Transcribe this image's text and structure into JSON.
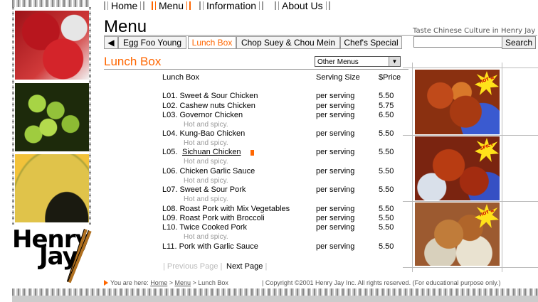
{
  "nav": {
    "items": [
      {
        "label": "Home",
        "active": false
      },
      {
        "label": "Menu",
        "active": true
      },
      {
        "label": "Information",
        "active": false
      },
      {
        "label": "About Us",
        "active": false
      }
    ]
  },
  "header": {
    "title": "Menu",
    "tagline": "Taste Chinese Culture in Henry Jay"
  },
  "tabs": [
    {
      "label": "Egg Foo Young",
      "selected": false
    },
    {
      "label": "Lunch Box",
      "selected": true
    },
    {
      "label": "Chop Suey & Chou Mein",
      "selected": false
    },
    {
      "label": "Chef's Special",
      "selected": false
    }
  ],
  "search": {
    "button_label": "Search",
    "value": ""
  },
  "section": {
    "title": "Lunch Box",
    "other_menus": "Other Menus"
  },
  "table": {
    "headers": {
      "item": "Lunch Box",
      "serving": "Serving Size",
      "price": "$Price"
    },
    "rows": [
      {
        "name": "L01. Sweet & Sour Chicken",
        "serving": "per serving",
        "price": "5.50",
        "note": ""
      },
      {
        "name": "L02. Cashew nuts Chicken",
        "serving": "per serving",
        "price": "5.75",
        "note": ""
      },
      {
        "name": "L03. Governor Chicken",
        "serving": "per serving",
        "price": "6.50",
        "note": "Hot and spicy."
      },
      {
        "name": "L04. Kung-Bao Chicken",
        "serving": "per serving",
        "price": "5.50",
        "note": "Hot and spicy."
      },
      {
        "name": "L05. Sichuan Chicken",
        "serving": "per serving",
        "price": "5.50",
        "note": "Hot and spicy."
      },
      {
        "name": "L06. Chicken Garlic Sauce",
        "serving": "per serving",
        "price": "5.50",
        "note": "Hot and spicy."
      },
      {
        "name": "L07. Sweet & Sour Pork",
        "serving": "per serving",
        "price": "5.50",
        "note": "Hot and spicy."
      },
      {
        "name": "L08. Roast Pork with Mix Vegetables",
        "serving": "per serving",
        "price": "5.50",
        "note": ""
      },
      {
        "name": "L09. Roast Pork with Broccoli",
        "serving": "per serving",
        "price": "5.50",
        "note": ""
      },
      {
        "name": "L10. Twice Cooked Pork",
        "serving": "per serving",
        "price": "5.50",
        "note": "Hot and spicy."
      },
      {
        "name": "L11. Pork with Garlic Sauce",
        "serving": "per serving",
        "price": "5.50",
        "note": ""
      }
    ]
  },
  "pager": {
    "previous": "Previous Page",
    "next": "Next Page"
  },
  "footer": {
    "you_are_here": "You are here:",
    "crumb_home": "Home",
    "crumb_menu": "Menu",
    "crumb_current": "Lunch Box",
    "copyright": "Copyright ©2001 Henry Jay Inc. All rights reserved. (For educational purpose only.)"
  },
  "logo": {
    "line1": "Henry",
    "line2": "Jay"
  },
  "badges": {
    "text1": "HOT &",
    "text2": "SPICY"
  },
  "colors": {
    "accent": "#ff6600",
    "muted": "#999999"
  }
}
